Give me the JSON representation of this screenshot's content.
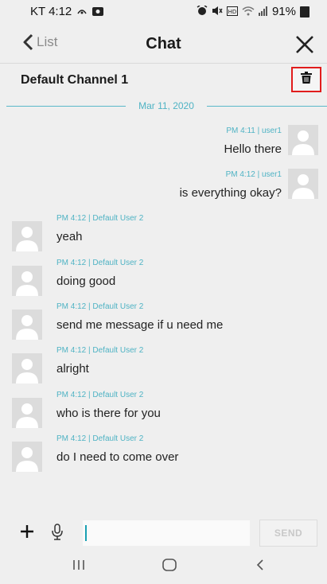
{
  "status_bar": {
    "carrier_time": "KT 4:12",
    "battery": "91%",
    "icons": [
      "nfc-icon",
      "photo-icon",
      "alarm-icon",
      "mute-icon",
      "hd-icon",
      "wifi-icon",
      "signal-icon",
      "battery-icon"
    ]
  },
  "header": {
    "back_label": "List",
    "title": "Chat",
    "back_icon": "chevron-left-icon",
    "close_icon": "close-icon"
  },
  "channel": {
    "name": "Default Channel 1",
    "delete_icon": "trash-icon",
    "highlight_color": "#e11c1c"
  },
  "date_divider": "Mar 11, 2020",
  "messages": [
    {
      "direction": "out",
      "meta": "PM 4:11 | user1",
      "text": "Hello there"
    },
    {
      "direction": "out",
      "meta": "PM 4:12 | user1",
      "text": "is everything okay?"
    },
    {
      "direction": "in",
      "meta": "PM 4:12 | Default User 2",
      "text": "yeah"
    },
    {
      "direction": "in",
      "meta": "PM 4:12 | Default User 2",
      "text": "doing good"
    },
    {
      "direction": "in",
      "meta": "PM 4:12 | Default User 2",
      "text": "send me message if u need me"
    },
    {
      "direction": "in",
      "meta": "PM 4:12 | Default User 2",
      "text": "alright"
    },
    {
      "direction": "in",
      "meta": "PM 4:12 | Default User 2",
      "text": "who is there for you"
    },
    {
      "direction": "in",
      "meta": "PM 4:12 | Default User 2",
      "text": "do I need to come over"
    }
  ],
  "input_bar": {
    "plus_icon": "plus-icon",
    "mic_icon": "microphone-icon",
    "input_value": "",
    "input_placeholder": "",
    "send_label": "SEND"
  },
  "nav_bar": {
    "recent_icon": "recent-apps-icon",
    "home_icon": "home-icon",
    "back_icon": "back-icon"
  },
  "colors": {
    "accent": "#4fb3c4",
    "background": "#efefef",
    "avatar_bg": "#dcdcdc"
  }
}
